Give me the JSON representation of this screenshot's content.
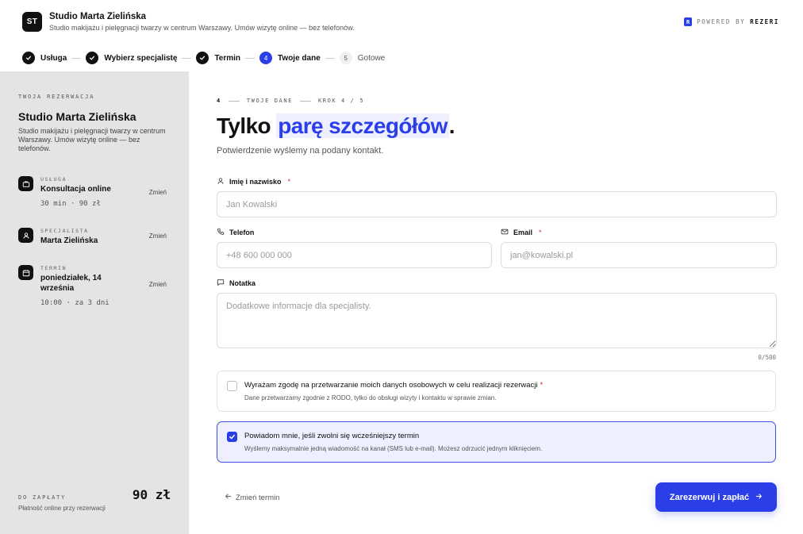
{
  "header": {
    "logo_text": "ST",
    "title": "Studio Marta Zielińska",
    "subtitle": "Studio makijażu i pielęgnacji twarzy w centrum Warszawy. Umów wizytę online — bez telefonów.",
    "powered_prefix": "POWERED BY",
    "powered_brand": "REZERI",
    "powered_icon_letter": "R"
  },
  "stepper": {
    "steps": [
      {
        "label": "Usługa",
        "state": "done",
        "icon": "check-icon"
      },
      {
        "label": "Wybierz specjalistę",
        "state": "done",
        "icon": "check-icon"
      },
      {
        "label": "Termin",
        "state": "done",
        "icon": "check-icon"
      },
      {
        "label": "Twoje dane",
        "state": "active",
        "number": "4"
      },
      {
        "label": "Gotowe",
        "state": "todo",
        "number": "5"
      }
    ]
  },
  "sidebar": {
    "eyebrow": "TWOJA REZERWACJA",
    "title": "Studio Marta Zielińska",
    "description": "Studio makijażu i pielęgnacji twarzy w centrum Warszawy. Umów wizytę online — bez telefonów.",
    "service": {
      "label": "USŁUGA",
      "value": "Konsultacja online",
      "meta": "30 min · 90 zł",
      "change": "Zmień",
      "icon": "briefcase-icon"
    },
    "specialist": {
      "label": "SPECJALISTA",
      "value": "Marta Zielińska",
      "change": "Zmień",
      "icon": "user-icon"
    },
    "term": {
      "label": "TERMIN",
      "value": "poniedziałek, 14 września",
      "meta": "10:00 · za 3 dni",
      "change": "Zmień",
      "icon": "calendar-icon"
    },
    "payment": {
      "label": "DO ZAPŁATY",
      "sub": "Płatność online przy rezerwacji",
      "amount": "90 zł"
    }
  },
  "main": {
    "eyebrow": {
      "num": "4",
      "section": "TWOJE DANE",
      "step": "KROK 4 / 5"
    },
    "headline_prefix": "Tylko ",
    "headline_accent": "parę szczegółów",
    "headline_suffix": ".",
    "subline": "Potwierdzenie wyślemy na podany kontakt.",
    "form": {
      "name": {
        "label": "Imię i nazwisko",
        "required": "*",
        "placeholder": "Jan Kowalski",
        "value": "",
        "icon": "user-icon"
      },
      "phone": {
        "label": "Telefon",
        "placeholder": "+48 600 000 000",
        "value": "",
        "icon": "phone-icon"
      },
      "email": {
        "label": "Email",
        "required": "*",
        "placeholder": "jan@kowalski.pl",
        "value": "",
        "icon": "mail-icon"
      },
      "note": {
        "label": "Notatka",
        "placeholder": "Dodatkowe informacje dla specjalisty.",
        "value": "",
        "counter": "0/500",
        "icon": "message-icon"
      }
    },
    "consents": [
      {
        "title": "Wyrażam zgodę na przetwarzanie moich danych osobowych w celu realizacji rezerwacji",
        "required": "*",
        "sub": "Dane przetwarzamy zgodnie z RODO, tylko do obsługi wizyty i kontaktu w sprawie zmian.",
        "checked": false
      },
      {
        "title": "Powiadom mnie, jeśli zwolni się wcześniejszy termin",
        "sub": "Wyślemy maksymalnie jedną wiadomość na kanał (SMS lub e-mail). Możesz odrzucić jednym kliknięciem.",
        "checked": true
      }
    ],
    "back_label": "Zmień termin",
    "submit_label": "Zarezerwuj i zapłać"
  },
  "colors": {
    "accent": "#2b3fe8",
    "accent_soft": "#eef0ff",
    "sidebar_bg": "#e4e4e4",
    "required": "#e02424"
  }
}
